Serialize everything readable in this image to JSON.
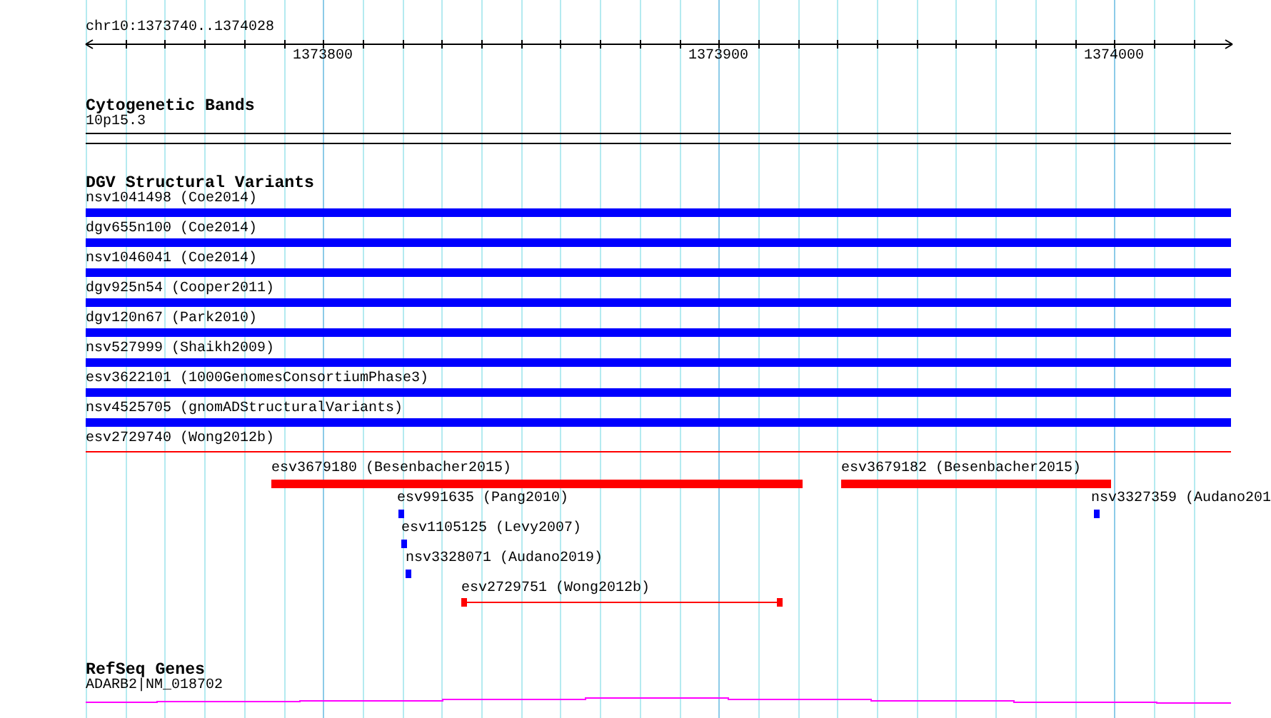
{
  "ruler": {
    "region": "chr10:1373740..1374028",
    "ticks": [
      "1373800",
      "1373900",
      "1374000"
    ]
  },
  "tracks": [
    {
      "title": "Cytogenetic Bands",
      "kind": "bands",
      "features": [
        {
          "label": "10p15.3"
        }
      ]
    },
    {
      "title": "DGV Structural Variants",
      "kind": "variants",
      "features": [
        {
          "label": "nsv1041498 (Coe2014)",
          "kind": "bar",
          "color": "#0000ff"
        },
        {
          "label": "dgv655n100 (Coe2014)",
          "kind": "bar",
          "color": "#0000ff"
        },
        {
          "label": "nsv1046041 (Coe2014)",
          "kind": "bar",
          "color": "#0000ff"
        },
        {
          "label": "dgv925n54 (Cooper2011)",
          "kind": "bar",
          "color": "#0000ff"
        },
        {
          "label": "dgv120n67 (Park2010)",
          "kind": "bar",
          "color": "#0000ff"
        },
        {
          "label": "nsv527999 (Shaikh2009)",
          "kind": "bar",
          "color": "#0000ff"
        },
        {
          "label": "esv3622101 (1000GenomesConsortiumPhase3)",
          "kind": "bar",
          "color": "#0000ff"
        },
        {
          "label": "nsv4525705 (gnomADStructuralVariants)",
          "kind": "bar",
          "color": "#0000ff"
        },
        {
          "label": "esv2729740 (Wong2012b)",
          "kind": "line",
          "color": "#ff0000"
        },
        {
          "label": "esv3679180 (Besenbacher2015)",
          "kind": "bar",
          "color": "#ff0000"
        },
        {
          "label": "esv3679182 (Besenbacher2015)",
          "kind": "bar",
          "color": "#ff0000"
        },
        {
          "label": "esv991635 (Pang2010)",
          "kind": "bar",
          "color": "#0000ff"
        },
        {
          "label": "nsv3327359 (Audano201",
          "kind": "bar",
          "color": "#0000ff"
        },
        {
          "label": "esv1105125 (Levy2007)",
          "kind": "bar",
          "color": "#0000ff"
        },
        {
          "label": "nsv3328071 (Audano2019)",
          "kind": "bar",
          "color": "#0000ff"
        },
        {
          "label": "esv2729751 (Wong2012b)",
          "kind": "span",
          "color": "#ff0000"
        }
      ]
    },
    {
      "title": "RefSeq Genes",
      "kind": "genes",
      "features": [
        {
          "label": "ADARB2|NM_018702"
        }
      ]
    }
  ]
}
